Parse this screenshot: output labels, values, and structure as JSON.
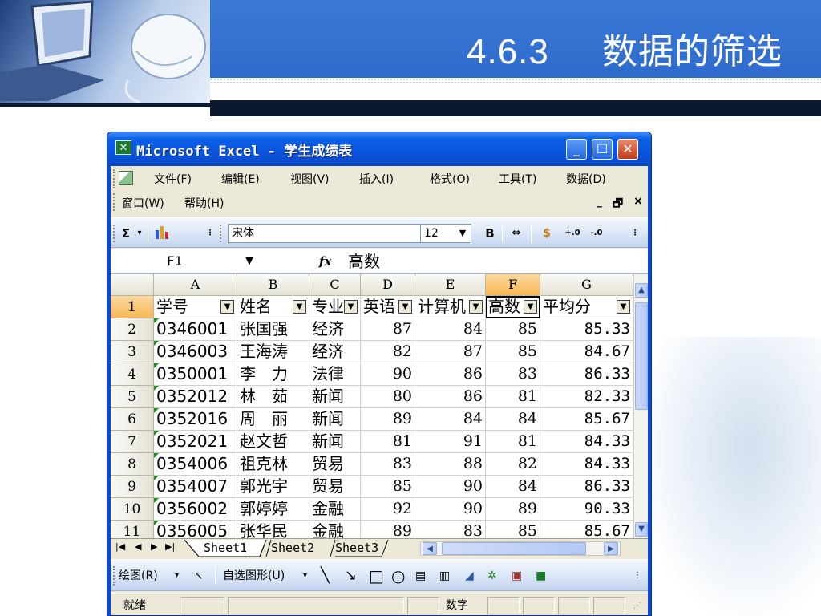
{
  "slide": {
    "title": "4.6.3     数据的筛选"
  },
  "window": {
    "title": "Microsoft Excel - 学生成绩表"
  },
  "menu": {
    "row1": [
      "文件(F)",
      "编辑(E)",
      "视图(V)",
      "插入(I)",
      "格式(O)",
      "工具(T)",
      "数据(D)"
    ],
    "row2": [
      "窗口(W)",
      "帮助(H)"
    ]
  },
  "toolbar": {
    "font_name": "宋体",
    "font_size": "12",
    "bold_label": "B"
  },
  "formula": {
    "name_box": "F1",
    "value": "高数"
  },
  "columns": [
    "A",
    "B",
    "C",
    "D",
    "E",
    "F",
    "G"
  ],
  "header_row": [
    "学号",
    "姓名",
    "专业",
    "英语",
    "计算机",
    "高数",
    "平均分"
  ],
  "rows": [
    [
      "0346001",
      "张国强",
      "经济",
      "87",
      "84",
      "85",
      "85.33"
    ],
    [
      "0346003",
      "王海涛",
      "经济",
      "82",
      "87",
      "85",
      "84.67"
    ],
    [
      "0350001",
      "李　力",
      "法律",
      "90",
      "86",
      "83",
      "86.33"
    ],
    [
      "0352012",
      "林　茹",
      "新闻",
      "80",
      "86",
      "81",
      "82.33"
    ],
    [
      "0352016",
      "周　丽",
      "新闻",
      "89",
      "84",
      "84",
      "85.67"
    ],
    [
      "0352021",
      "赵文哲",
      "新闻",
      "81",
      "91",
      "81",
      "84.33"
    ],
    [
      "0354006",
      "祖克林",
      "贸易",
      "83",
      "88",
      "82",
      "84.33"
    ],
    [
      "0354007",
      "郭光宇",
      "贸易",
      "85",
      "90",
      "84",
      "86.33"
    ],
    [
      "0356002",
      "郭婷婷",
      "金融",
      "92",
      "90",
      "89",
      "90.33"
    ],
    [
      "0356005",
      "张华民",
      "金融",
      "89",
      "83",
      "85",
      "85.67"
    ]
  ],
  "sheet_tabs": [
    "Sheet1",
    "Sheet2",
    "Sheet3"
  ],
  "draw_bar": {
    "draw_label": "绘图(R)",
    "autoshape_label": "自选图形(U)"
  },
  "status": {
    "ready": "就绪",
    "numlock": "数字"
  }
}
